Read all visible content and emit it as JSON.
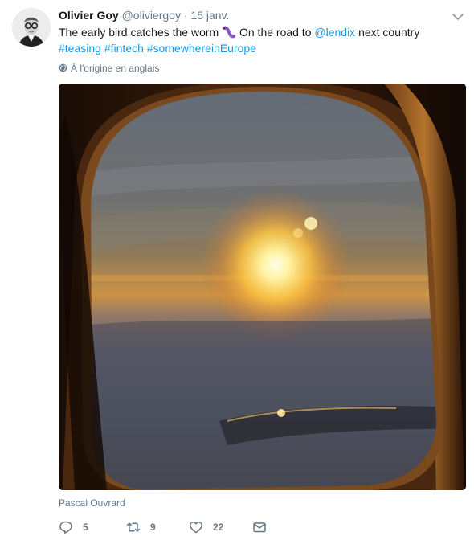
{
  "tweet": {
    "name": "Olivier Goy",
    "handle": "@oliviergoy",
    "separator": "·",
    "date": "15 janv.",
    "text_part1": "The early bird catches the worm ",
    "text_part2": " On the road to ",
    "mention": "@lendix",
    "text_part3": " next country",
    "hashtags": [
      "#teasing",
      "#fintech",
      "#somewhereinEurope"
    ],
    "translation_label": "À l'origine en anglais",
    "photo_credit": "Pascal Ouvrard",
    "actions": {
      "replies": "5",
      "retweets": "9",
      "likes": "22"
    },
    "colors": {
      "link": "#1b95e0",
      "muted": "#657786",
      "text": "#14171a"
    }
  }
}
